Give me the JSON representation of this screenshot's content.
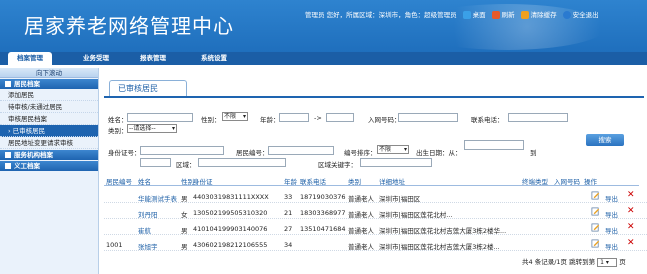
{
  "header": {
    "title": "居家养老网络管理中心",
    "info": "管理员 您好，所属区域：深圳市，角色：超级管理员",
    "home": "桌面",
    "refresh": "刷新",
    "clear_cache": "清除缓存",
    "logout": "安全退出"
  },
  "nav": {
    "tabs": [
      "档案管理",
      "业务受理",
      "报表管理",
      "系统设置"
    ]
  },
  "sidebar": {
    "guide": "向下滚动",
    "sec1": "居民档案",
    "items": [
      "添加居民",
      "待审核/未通过居民",
      "审核居民档案",
      "已审核居民",
      "居民地址变更请求审核"
    ],
    "sec2": "服务机构档案",
    "sec3": "义工档案"
  },
  "main": {
    "title": "已审核居民",
    "filter": {
      "name": "姓名：",
      "gender": "性别：",
      "gender_val": "不限",
      "age": "年龄：",
      "age_sep": "->",
      "net_no": "入网号码：",
      "phone": "联系电话：",
      "category": "类别：",
      "category_val": "--请选择--",
      "idcard": "身份证号：",
      "resident_no": "居民编号：",
      "sort": "编号排序：",
      "sort_val": "不限",
      "birth": "出生日期：从：",
      "birth_to": "到",
      "area": "区域：",
      "area_kw": "区域关键字：",
      "search": "搜索"
    },
    "columns": [
      "居民编号",
      "姓名",
      "性别",
      "身份证",
      "年龄",
      "联系电话",
      "类别",
      "详细地址",
      "终端类型",
      "入网号码",
      "操作"
    ],
    "rows": [
      {
        "no": "",
        "name": "华能测试手表",
        "gender": "男",
        "idcard": "44030319831111XXXX",
        "age": "33",
        "phone": "18719030376",
        "category": "普通老人",
        "address": "深圳市|福田区"
      },
      {
        "no": "",
        "name": "刘丹阳",
        "gender": "女",
        "idcard": "130502199505310320",
        "age": "21",
        "phone": "18303368977",
        "category": "普通老人",
        "address": "深圳市|福田区莲花北村..."
      },
      {
        "no": "",
        "name": "崔航",
        "gender": "男",
        "idcard": "410104199903140076",
        "age": "27",
        "phone": "13510471684",
        "category": "普通老人",
        "address": "深圳市|福田区莲花北村吉莲大厦3栋2楼华..."
      },
      {
        "no": "1001",
        "name": "张旭宇",
        "gender": "男",
        "idcard": "430602198212106555",
        "age": "34",
        "phone": "",
        "category": "普通老人",
        "address": "深圳市|福田区莲花北村吉莲大厦3栋2楼..."
      }
    ],
    "export_label": "导出",
    "delete_label": "✕",
    "pager": {
      "info": "共4 条记录/1页 跳转到第",
      "page": "1",
      "unit": "页"
    }
  }
}
